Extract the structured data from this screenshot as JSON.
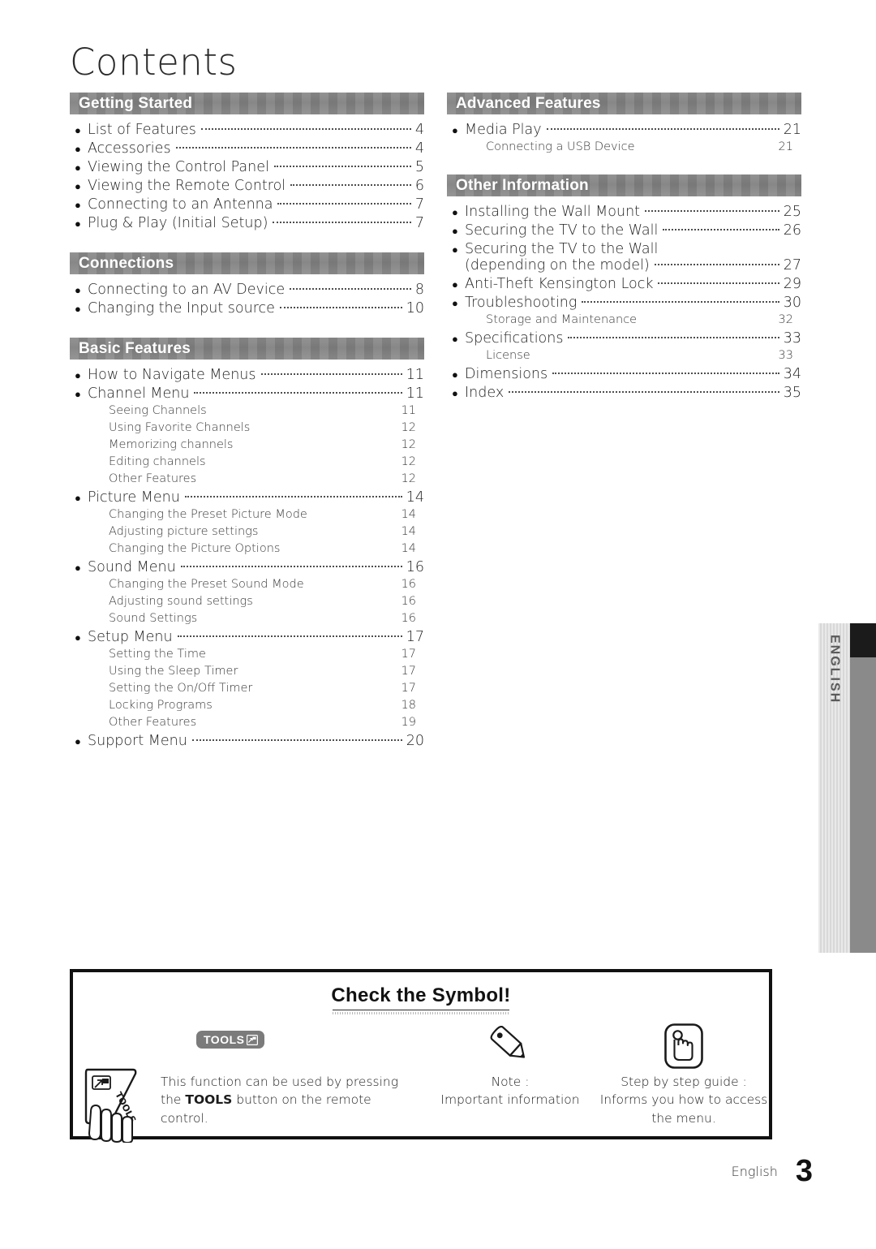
{
  "page": {
    "title": "Contents",
    "footer_language": "English",
    "footer_page_number": "3",
    "side_tab_label": "ENGLISH"
  },
  "columns": {
    "left": [
      {
        "heading": "Getting Started",
        "entries": [
          {
            "level": "main",
            "text": "List of Features",
            "page": "4"
          },
          {
            "level": "main",
            "text": "Accessories",
            "page": "4"
          },
          {
            "level": "main",
            "text": "Viewing the Control Panel",
            "page": "5"
          },
          {
            "level": "main",
            "text": "Viewing the Remote Control",
            "page": "6"
          },
          {
            "level": "main",
            "text": "Connecting to an Antenna",
            "page": "7"
          },
          {
            "level": "main",
            "text": "Plug & Play (Initial Setup)",
            "page": "7"
          }
        ]
      },
      {
        "heading": "Connections",
        "entries": [
          {
            "level": "main",
            "text": "Connecting to an AV Device",
            "page": "8"
          },
          {
            "level": "main",
            "text": "Changing the Input source",
            "page": "10"
          }
        ]
      },
      {
        "heading": "Basic Features",
        "entries": [
          {
            "level": "main",
            "text": "How to Navigate Menus",
            "page": "11"
          },
          {
            "level": "main",
            "text": "Channel Menu",
            "page": "11"
          },
          {
            "level": "sub",
            "text": "Seeing Channels",
            "page": "11"
          },
          {
            "level": "sub",
            "text": "Using Favorite Channels",
            "page": "12"
          },
          {
            "level": "sub",
            "text": "Memorizing channels",
            "page": "12"
          },
          {
            "level": "sub",
            "text": "Editing channels",
            "page": "12"
          },
          {
            "level": "sub",
            "text": "Other Features",
            "page": "12"
          },
          {
            "level": "main",
            "text": "Picture Menu",
            "page": "14"
          },
          {
            "level": "sub",
            "text": "Changing the Preset Picture Mode",
            "page": "14"
          },
          {
            "level": "sub",
            "text": "Adjusting picture settings",
            "page": "14"
          },
          {
            "level": "sub",
            "text": "Changing the Picture Options",
            "page": "14"
          },
          {
            "level": "main",
            "text": "Sound Menu",
            "page": "16"
          },
          {
            "level": "sub",
            "text": "Changing the Preset Sound Mode",
            "page": "16"
          },
          {
            "level": "sub",
            "text": "Adjusting sound settings",
            "page": "16"
          },
          {
            "level": "sub",
            "text": "Sound Settings",
            "page": "16"
          },
          {
            "level": "main",
            "text": "Setup Menu",
            "page": "17"
          },
          {
            "level": "sub",
            "text": "Setting the Time",
            "page": "17"
          },
          {
            "level": "sub",
            "text": "Using the Sleep Timer",
            "page": "17"
          },
          {
            "level": "sub",
            "text": "Setting the On/Off Timer",
            "page": "17"
          },
          {
            "level": "sub",
            "text": "Locking Programs",
            "page": "18"
          },
          {
            "level": "sub",
            "text": "Other Features",
            "page": "19"
          },
          {
            "level": "main",
            "text": "Support Menu",
            "page": "20"
          }
        ]
      }
    ],
    "right": [
      {
        "heading": "Advanced Features",
        "entries": [
          {
            "level": "main",
            "text": "Media Play",
            "page": "21"
          },
          {
            "level": "sub",
            "text": "Connecting a USB Device",
            "page": "21"
          }
        ]
      },
      {
        "heading": "Other Information",
        "entries": [
          {
            "level": "main",
            "text": "Installing the Wall Mount",
            "page": "25"
          },
          {
            "level": "main",
            "text": "Securing the TV to the Wall",
            "page": "26"
          },
          {
            "level": "main2",
            "text": "Securing the TV to the Wall",
            "text2": "(depending on the model)",
            "page": "27"
          },
          {
            "level": "main",
            "text": "Anti-Theft Kensington Lock",
            "page": "29"
          },
          {
            "level": "main",
            "text": "Troubleshooting",
            "page": "30"
          },
          {
            "level": "sub",
            "text": "Storage and Maintenance",
            "page": "32"
          },
          {
            "level": "main",
            "text": "Specifications",
            "page": "33"
          },
          {
            "level": "sub",
            "text": "License",
            "page": "33"
          },
          {
            "level": "main",
            "text": "Dimensions",
            "page": "34"
          },
          {
            "level": "main",
            "text": "Index",
            "page": "35"
          }
        ]
      }
    ]
  },
  "symbol_box": {
    "title": "Check the Symbol!",
    "items": [
      {
        "badge_label": "TOOLS",
        "text_part1": "This function can be used by pressing the ",
        "text_bold": "TOOLS",
        "text_part2": " button on the remote control."
      },
      {
        "line1": "Note :",
        "line2": "Important information"
      },
      {
        "line1": "Step by step guide :",
        "line2": "Informs you how to access the menu."
      }
    ]
  },
  "colors": {
    "section_header_bg": "#808080",
    "section_header_text": "#ffffff",
    "tools_badge_bg": "#7b7b7b",
    "box_border": "#111111",
    "side_tab_dark": "#8a8a8a"
  }
}
